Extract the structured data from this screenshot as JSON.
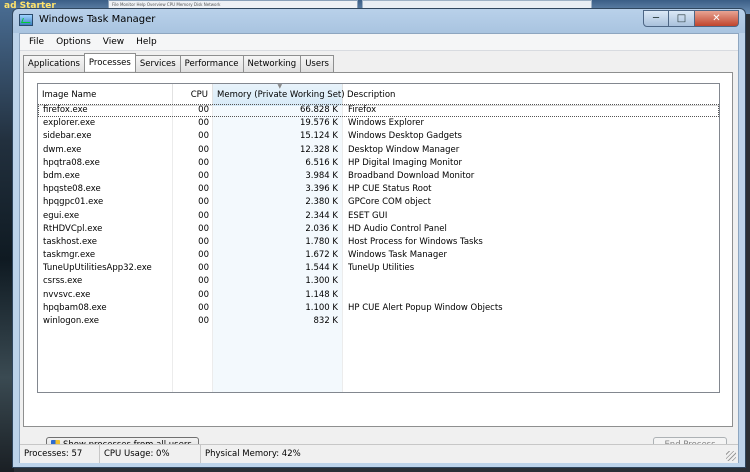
{
  "background": {
    "top_left_tag": "ad Starter",
    "inner_window_text": "File  Monitor  Help  Overview  CPU  Memory  Disk  Network"
  },
  "window": {
    "title": "Windows Task Manager",
    "min_icon": "minimize-icon",
    "max_icon": "maximize-icon",
    "close_icon": "close-icon"
  },
  "menu": [
    "File",
    "Options",
    "View",
    "Help"
  ],
  "tabs": [
    "Applications",
    "Processes",
    "Services",
    "Performance",
    "Networking",
    "Users"
  ],
  "active_tab": "Processes",
  "columns": {
    "name": "Image Name",
    "cpu": "CPU",
    "memory": "Memory (Private Working Set)",
    "description": "Description"
  },
  "processes": [
    {
      "name": "firefox.exe",
      "cpu": "00",
      "memory": "66.828 K",
      "description": "Firefox"
    },
    {
      "name": "explorer.exe",
      "cpu": "00",
      "memory": "19.576 K",
      "description": "Windows Explorer"
    },
    {
      "name": "sidebar.exe",
      "cpu": "00",
      "memory": "15.124 K",
      "description": "Windows Desktop Gadgets"
    },
    {
      "name": "dwm.exe",
      "cpu": "00",
      "memory": "12.328 K",
      "description": "Desktop Window Manager"
    },
    {
      "name": "hpqtra08.exe",
      "cpu": "00",
      "memory": "6.516 K",
      "description": "HP Digital Imaging Monitor"
    },
    {
      "name": "bdm.exe",
      "cpu": "00",
      "memory": "3.984 K",
      "description": "Broadband Download Monitor"
    },
    {
      "name": "hpqste08.exe",
      "cpu": "00",
      "memory": "3.396 K",
      "description": "HP CUE Status Root"
    },
    {
      "name": "hpqgpc01.exe",
      "cpu": "00",
      "memory": "2.380 K",
      "description": "GPCore COM object"
    },
    {
      "name": "egui.exe",
      "cpu": "00",
      "memory": "2.344 K",
      "description": "ESET GUI"
    },
    {
      "name": "RtHDVCpl.exe",
      "cpu": "00",
      "memory": "2.036 K",
      "description": "HD Audio Control Panel"
    },
    {
      "name": "taskhost.exe",
      "cpu": "00",
      "memory": "1.780 K",
      "description": "Host Process for Windows Tasks"
    },
    {
      "name": "taskmgr.exe",
      "cpu": "00",
      "memory": "1.672 K",
      "description": "Windows Task Manager"
    },
    {
      "name": "TuneUpUtilitiesApp32.exe",
      "cpu": "00",
      "memory": "1.544 K",
      "description": "TuneUp Utilities"
    },
    {
      "name": "csrss.exe",
      "cpu": "00",
      "memory": "1.300 K",
      "description": ""
    },
    {
      "name": "nvvsvc.exe",
      "cpu": "00",
      "memory": "1.148 K",
      "description": ""
    },
    {
      "name": "hpqbam08.exe",
      "cpu": "00",
      "memory": "1.100 K",
      "description": "HP CUE Alert Popup Window Objects"
    },
    {
      "name": "winlogon.exe",
      "cpu": "00",
      "memory": "832 K",
      "description": ""
    }
  ],
  "selected_row": 0,
  "buttons": {
    "show_all": "Show processes from all users",
    "end_process": "End Process"
  },
  "status": {
    "processes": "Processes: 57",
    "cpu": "CPU Usage: 0%",
    "memory": "Physical Memory: 42%"
  }
}
